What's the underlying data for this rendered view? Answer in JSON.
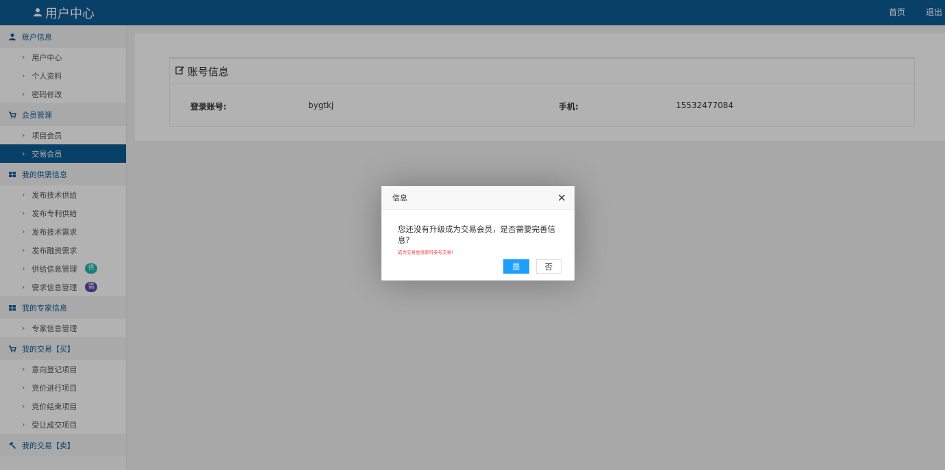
{
  "header": {
    "title": "用户中心",
    "links": [
      "首页",
      "退出"
    ]
  },
  "sidebar": [
    {
      "title": "账户信息",
      "icon": "user-icon",
      "items": [
        {
          "label": "用户中心"
        },
        {
          "label": "个人资料"
        },
        {
          "label": "密码修改"
        }
      ]
    },
    {
      "title": "会员管理",
      "icon": "cart-icon",
      "items": [
        {
          "label": "项目会员"
        },
        {
          "label": "交易会员",
          "active": true
        }
      ]
    },
    {
      "title": "我的供需信息",
      "icon": "grid-icon",
      "items": [
        {
          "label": "发布技术供给"
        },
        {
          "label": "发布专利供给"
        },
        {
          "label": "发布技术需求"
        },
        {
          "label": "发布融资需求"
        },
        {
          "label": "供给信息管理",
          "badge": "供",
          "badge_color": "#23b7a8"
        },
        {
          "label": "需求信息管理",
          "badge": "需",
          "badge_color": "#5b4fa8"
        }
      ]
    },
    {
      "title": "我的专家信息",
      "icon": "grid-icon",
      "items": [
        {
          "label": "专家信息管理"
        }
      ]
    },
    {
      "title": "我的交易【买】",
      "icon": "cart-icon",
      "items": [
        {
          "label": "意向登记项目"
        },
        {
          "label": "竞价进行项目"
        },
        {
          "label": "竞价结束项目"
        },
        {
          "label": "受让成交项目"
        }
      ]
    },
    {
      "title": "我的交易【卖】",
      "icon": "gavel-icon",
      "items": []
    }
  ],
  "account": {
    "title": "账号信息",
    "login_label": "登录账号:",
    "login_value": "bygtkj",
    "phone_label": "手机:",
    "phone_value": "15532477084"
  },
  "dialog": {
    "title": "信息",
    "close": "×",
    "message": "您还没有升级成为交易会员，是否需要完善信息?",
    "note": "成为交易会员即可参与交易!",
    "yes": "是",
    "no": "否"
  },
  "colors": {
    "brand": "#0e5c96",
    "primary_button": "#1e9fff",
    "note": "#ee3333"
  }
}
